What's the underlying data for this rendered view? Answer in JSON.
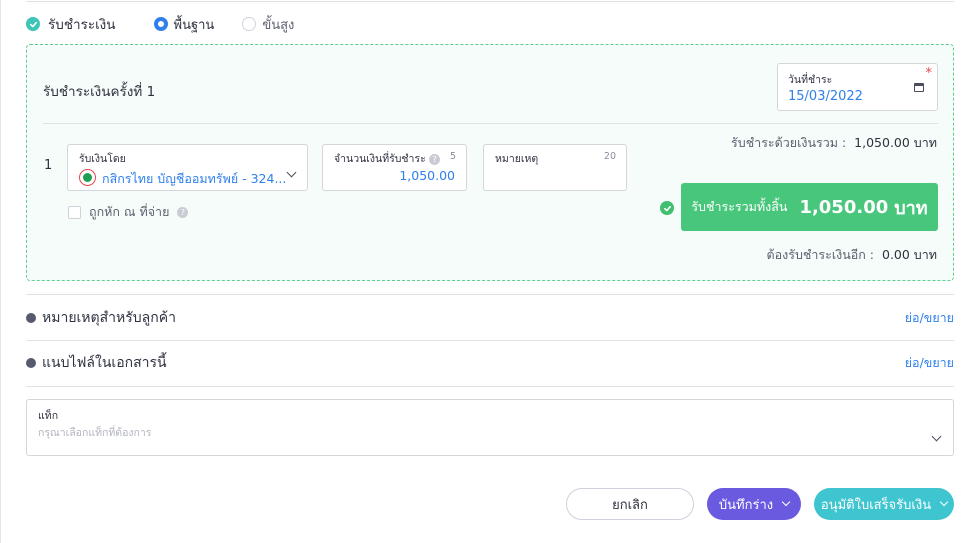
{
  "mode": {
    "title": "รับชำระเงิน",
    "options": [
      {
        "label": "พื้นฐาน",
        "selected": true
      },
      {
        "label": "ขั้นสูง",
        "selected": false
      }
    ]
  },
  "payment": {
    "title": "รับชำระเงินครั้งที่ 1",
    "date_label": "วันที่ชำระ",
    "date_value": "15/03/2022",
    "required_mark": "*",
    "row_number": "1",
    "received_by": {
      "label": "รับเงินโดย",
      "value": "กสิกรไทย บัญชีออมทรัพย์ - 324..."
    },
    "amount": {
      "label": "จำนวนเงินที่รับชำระ",
      "count": "5",
      "value": "1,050.00"
    },
    "note": {
      "label": "หมายเหตุ",
      "count": "20"
    },
    "withholding_label": "ถูกหัก ณ ที่จ่าย",
    "sum_label": "รับชำระด้วยเงินรวม :",
    "sum_value": "1,050.00 บาท",
    "total_label": "รับชำระรวมทั้งสิ้น",
    "total_amount": "1,050.00",
    "total_unit": "บาท",
    "remaining_label": "ต้องรับชำระเงินอีก :",
    "remaining_value": "0.00 บาท"
  },
  "sections": [
    {
      "title": "หมายเหตุสำหรับลูกค้า",
      "toggle": "ย่อ/ขยาย"
    },
    {
      "title": "แนบไฟล์ในเอกสารนี้",
      "toggle": "ย่อ/ขยาย"
    }
  ],
  "tag": {
    "label": "แท็ก",
    "placeholder": "กรุณาเลือกแท็กที่ต้องการ"
  },
  "buttons": {
    "cancel": "ยกเลิก",
    "draft": "บันทึกร่าง",
    "approve": "อนุมัติใบเสร็จรับเงิน"
  },
  "colors": {
    "accent_blue": "#2f80ed",
    "success_green": "#48c77c",
    "draft_purple": "#6a5ae0",
    "approve_teal": "#3ec5cf"
  }
}
